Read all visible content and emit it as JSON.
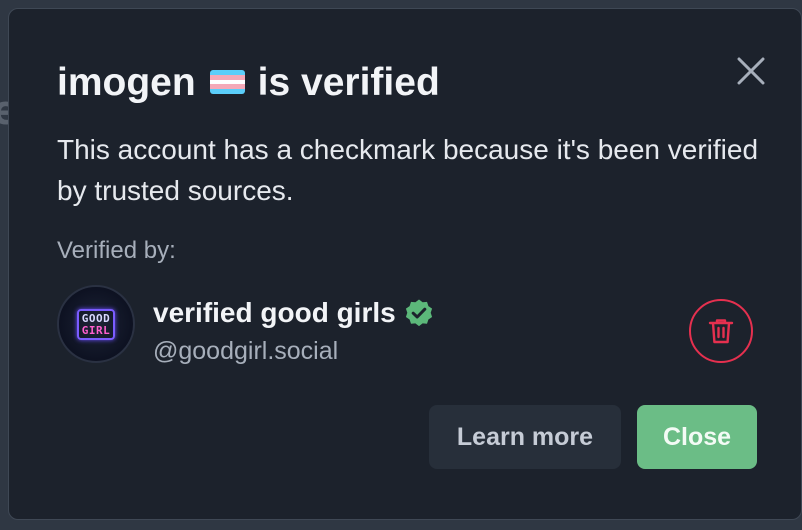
{
  "dialog": {
    "title_name": "imogen",
    "title_suffix": "is verified",
    "flag_icon": "transgender-flag-icon",
    "flag_colors": [
      "#5bcefa",
      "#f5a9b8",
      "#ffffff",
      "#f5a9b8",
      "#5bcefa"
    ],
    "description": "This account has a checkmark because it's been verified by trusted sources.",
    "verified_by_label": "Verified by:",
    "close_icon": "close-icon"
  },
  "verifier": {
    "avatar_text_top": "GOOD",
    "avatar_text_bottom": "GIRL",
    "name": "verified good girls",
    "handle": "@goodgirl.social",
    "badge_icon": "verified-check-badge-icon",
    "badge_color": "#5cb87a",
    "remove_icon": "trash-icon",
    "remove_color": "#e5304f"
  },
  "actions": {
    "learn_more_label": "Learn more",
    "close_label": "Close"
  },
  "colors": {
    "dialog_bg": "#1c222c",
    "accent_green": "#6bbd86",
    "secondary_button_bg": "#272f3a",
    "danger": "#e5304f"
  }
}
